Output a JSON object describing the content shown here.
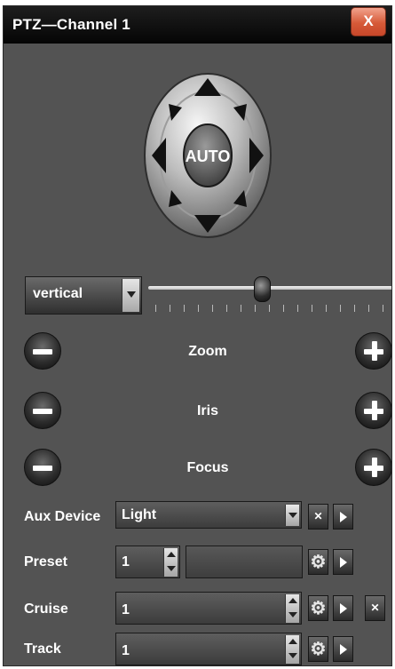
{
  "window": {
    "title": "PTZ—Channel 1",
    "close_label": "X",
    "accent_color": "#d65a38"
  },
  "direction_pad": {
    "center_label": "AUTO",
    "directions": [
      "up",
      "up-right",
      "right",
      "down-right",
      "down",
      "down-left",
      "left",
      "up-left"
    ]
  },
  "speed": {
    "mode_value": "vertical",
    "slider_level_fraction": 0.46
  },
  "controls": [
    {
      "label": "Zoom",
      "minus_icon": "minus-icon",
      "plus_icon": "plus-icon"
    },
    {
      "label": "Iris",
      "minus_icon": "minus-icon",
      "plus_icon": "plus-icon"
    },
    {
      "label": "Focus",
      "minus_icon": "minus-icon",
      "plus_icon": "plus-icon"
    }
  ],
  "aux_device": {
    "label": "Aux Device",
    "value": "Light"
  },
  "preset": {
    "label": "Preset",
    "value": "1"
  },
  "cruise": {
    "label": "Cruise",
    "value": "1"
  },
  "track": {
    "label": "Track",
    "value": "1"
  },
  "icons": {
    "settings": "gear-icon",
    "play": "play-icon",
    "clear": "x-icon"
  }
}
